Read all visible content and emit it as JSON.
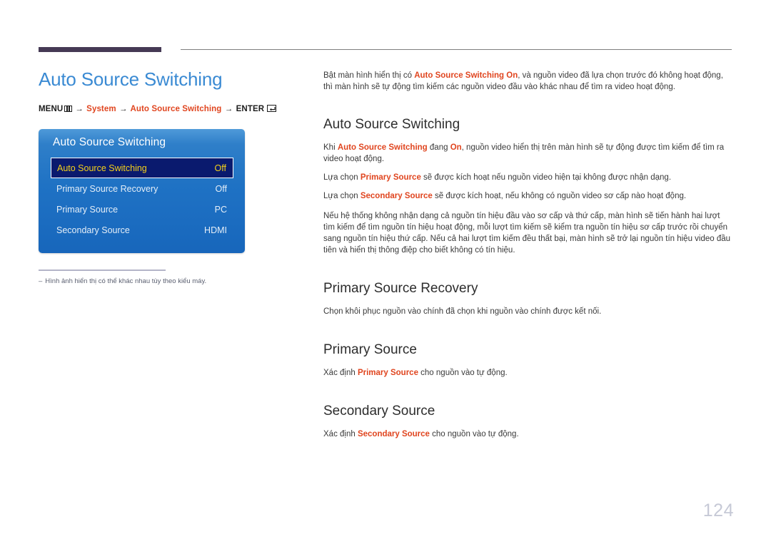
{
  "page": {
    "number": "124",
    "title": "Auto Source Switching"
  },
  "breadcrumb": {
    "menu_label": "MENU",
    "menu_icon": "menu-grid-icon",
    "arrow": "→",
    "step_system": "System",
    "step_auto_source": "Auto Source Switching",
    "enter_label": "ENTER",
    "enter_icon": "enter-key-icon"
  },
  "osd": {
    "title": "Auto Source Switching",
    "rows": [
      {
        "label": "Auto Source Switching",
        "value": "Off",
        "selected": true
      },
      {
        "label": "Primary Source Recovery",
        "value": "Off",
        "selected": false
      },
      {
        "label": "Primary Source",
        "value": "PC",
        "selected": false
      },
      {
        "label": "Secondary Source",
        "value": "HDMI",
        "selected": false
      }
    ]
  },
  "footnote": {
    "dash": "–",
    "text": "Hình ảnh hiển thị có thể khác nhau tùy theo kiểu máy."
  },
  "content": {
    "intro": {
      "part1": "Bật màn hình hiển thị có ",
      "kw1": "Auto Source Switching On",
      "part2": ", và nguồn video đã lựa chọn trước đó không hoạt động, thì màn hình sẽ tự động tìm kiếm các nguồn video đầu vào khác nhau để tìm ra video hoạt động."
    },
    "sections": [
      {
        "heading": "Auto Source Switching",
        "paragraphs": [
          {
            "part1": "Khi ",
            "kw1": "Auto Source Switching",
            "part2": " đang ",
            "kw2": "On",
            "part3": ", nguồn video hiển thị trên màn hình sẽ tự động được tìm kiếm để tìm ra video hoạt động."
          },
          {
            "part1": "Lựa chọn ",
            "kw1": "Primary Source",
            "part2": " sẽ được kích hoạt nếu nguồn video hiện tại không được nhận dạng."
          },
          {
            "part1": "Lựa chọn ",
            "kw1": "Secondary Source",
            "part2": " sẽ được kích hoạt, nếu không có nguồn video sơ cấp nào hoạt động."
          },
          {
            "part1": "Nếu hệ thống không nhận dạng cả nguồn tín hiệu đầu vào sơ cấp và thứ cấp, màn hình sẽ tiến hành hai lượt tìm kiếm để tìm nguồn tín hiệu hoạt động, mỗi lượt tìm kiếm sẽ kiểm tra nguồn tín hiệu sơ cấp trước rồi chuyển sang nguồn tín hiệu thứ cấp. Nếu cả hai lượt tìm kiếm đều thất bại, màn hình sẽ trở lại nguồn tín hiệu video đầu tiên và hiển thị thông điệp cho biết không có tín hiệu."
          }
        ]
      },
      {
        "heading": "Primary Source Recovery",
        "paragraph": "Chọn khôi phục nguồn vào chính đã chọn khi nguồn vào chính được kết nối."
      },
      {
        "heading": "Primary Source",
        "para_part1": "Xác định ",
        "para_kw": "Primary Source",
        "para_part2": " cho nguồn vào tự động."
      },
      {
        "heading": "Secondary Source",
        "para_part1": "Xác định ",
        "para_kw": "Secondary Source",
        "para_part2": " cho nguồn vào tự động."
      }
    ]
  },
  "colors": {
    "title_blue": "#3a8ad3",
    "keyword_orange": "#e0451f",
    "osd_blue": "#1f72c4",
    "osd_selected_bg": "#0a1a6e",
    "osd_selected_text": "#f5d11a",
    "rule_purple": "#463a55",
    "page_number_gray": "#c6c9d6"
  }
}
